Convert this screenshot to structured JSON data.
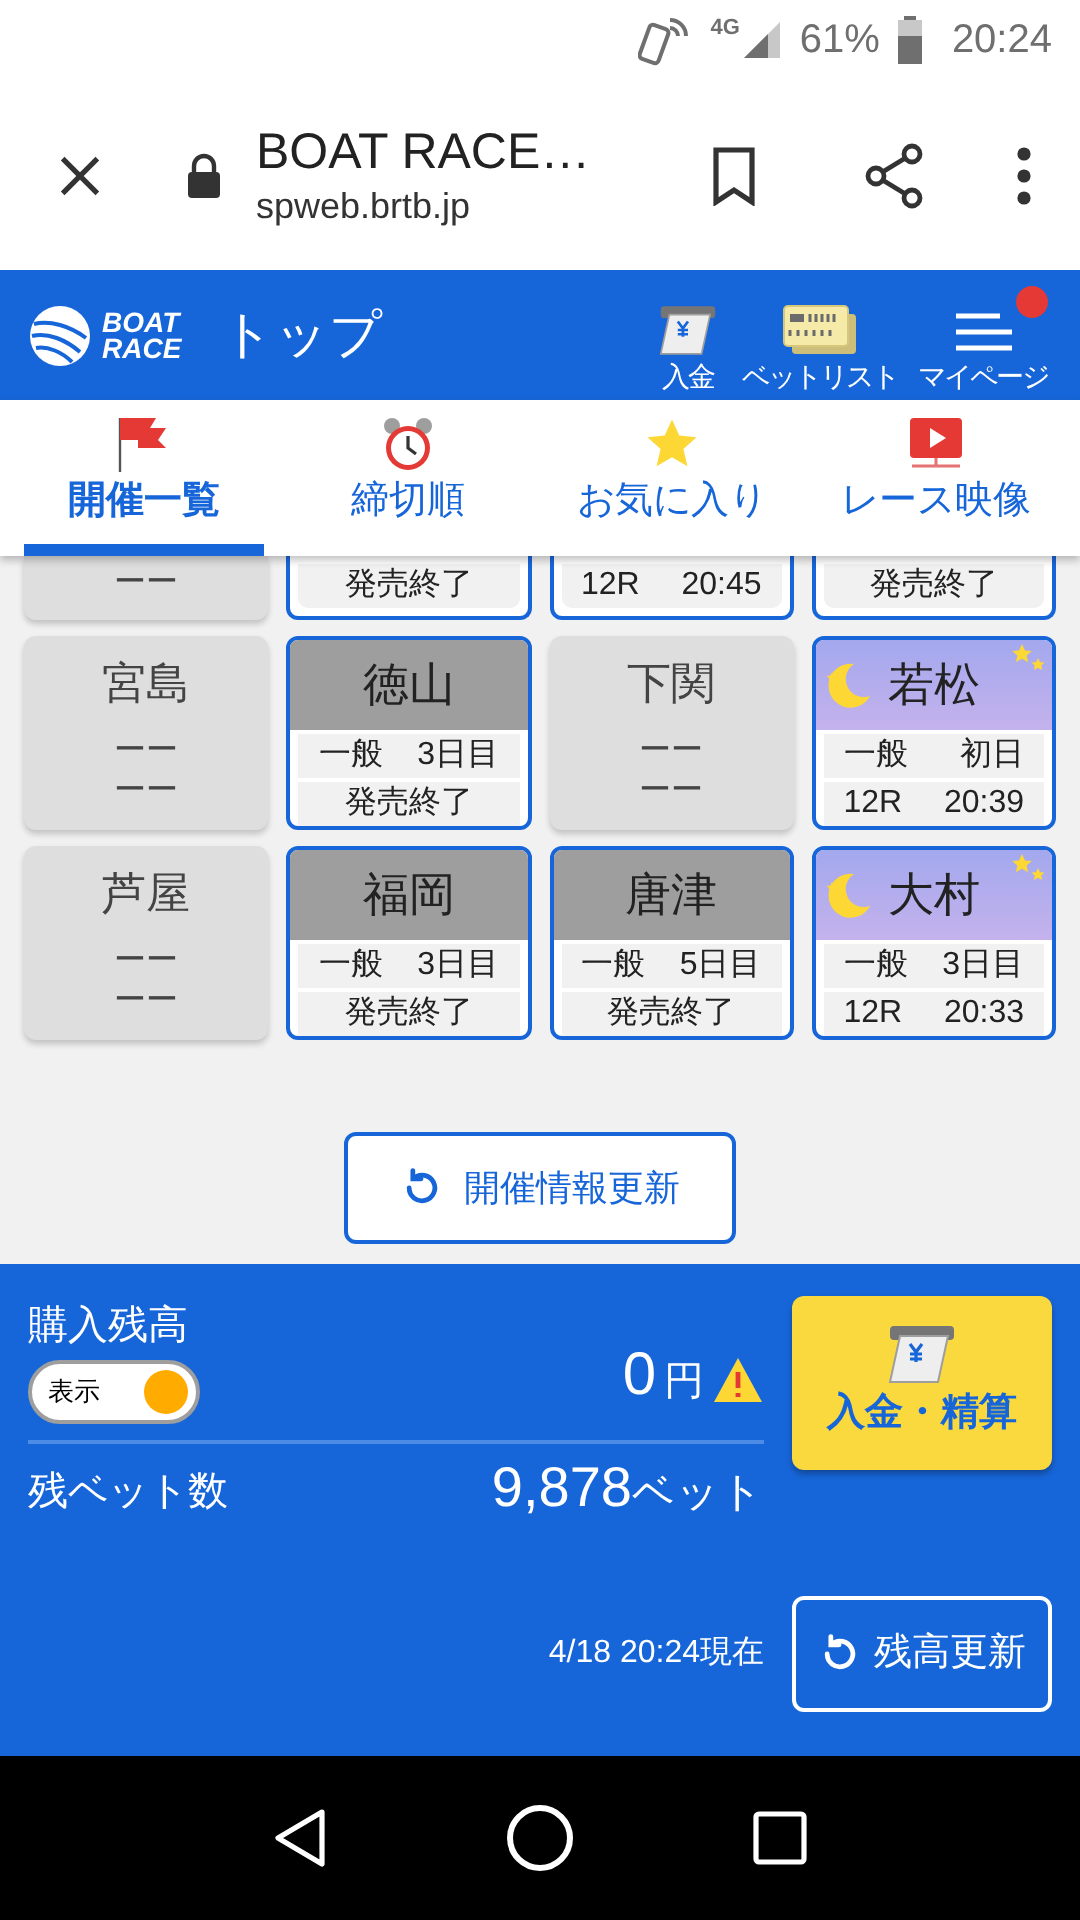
{
  "status_bar": {
    "network": "4G",
    "battery": "61%",
    "time": "20:24"
  },
  "browser": {
    "title": "BOAT RACE…",
    "url": "spweb.brtb.jp"
  },
  "header": {
    "logo": [
      "BOAT",
      "RACE"
    ],
    "title": "トップ",
    "actions": [
      {
        "kind": "deposit",
        "label": "入金",
        "badge": false
      },
      {
        "kind": "betlist",
        "label": "ベットリスト",
        "badge": false
      },
      {
        "kind": "menu",
        "label": "マイページ",
        "badge": true
      }
    ]
  },
  "tabs": [
    {
      "kind": "flag",
      "label": "開催一覧",
      "selected": true
    },
    {
      "kind": "clock",
      "label": "締切順",
      "selected": false
    },
    {
      "kind": "star",
      "label": "お気に入り",
      "selected": false
    },
    {
      "kind": "video",
      "label": "レース映像",
      "selected": false
    }
  ],
  "partial_row": [
    {
      "kind": "closed",
      "line": [
        "ーー"
      ]
    },
    {
      "kind": "day",
      "line": [
        "発売終了"
      ]
    },
    {
      "kind": "day",
      "line": [
        "12R",
        "20:45"
      ]
    },
    {
      "kind": "night",
      "line": [
        "発売終了"
      ]
    }
  ],
  "venues": [
    {
      "kind": "closed",
      "name": "宮島",
      "lines": [
        [
          "ーー"
        ],
        [
          "ーー"
        ]
      ]
    },
    {
      "kind": "day",
      "name": "徳山",
      "lines": [
        [
          "一般",
          "3日目"
        ],
        [
          "発売終了"
        ]
      ]
    },
    {
      "kind": "closed",
      "name": "下関",
      "lines": [
        [
          "ーー"
        ],
        [
          "ーー"
        ]
      ]
    },
    {
      "kind": "night",
      "name": "若松",
      "lines": [
        [
          "一般",
          "初日"
        ],
        [
          "12R",
          "20:39"
        ]
      ]
    },
    {
      "kind": "closed",
      "name": "芦屋",
      "lines": [
        [
          "ーー"
        ],
        [
          "ーー"
        ]
      ]
    },
    {
      "kind": "day",
      "name": "福岡",
      "lines": [
        [
          "一般",
          "3日目"
        ],
        [
          "発売終了"
        ]
      ]
    },
    {
      "kind": "day",
      "name": "唐津",
      "lines": [
        [
          "一般",
          "5日目"
        ],
        [
          "発売終了"
        ]
      ]
    },
    {
      "kind": "night",
      "name": "大村",
      "lines": [
        [
          "一般",
          "3日目"
        ],
        [
          "12R",
          "20:33"
        ]
      ]
    }
  ],
  "refresh_button": "開催情報更新",
  "account": {
    "balance_label": "購入残高",
    "toggle": {
      "label": "表示",
      "on": true
    },
    "balance": "0",
    "balance_unit": "円",
    "warning": true,
    "bets_label": "残ベット数",
    "bets": "9,878",
    "bets_unit": "ベット",
    "deposit_button": "入金・精算",
    "timestamp": "4/18 20:24現在",
    "refresh_button": "残高更新"
  }
}
